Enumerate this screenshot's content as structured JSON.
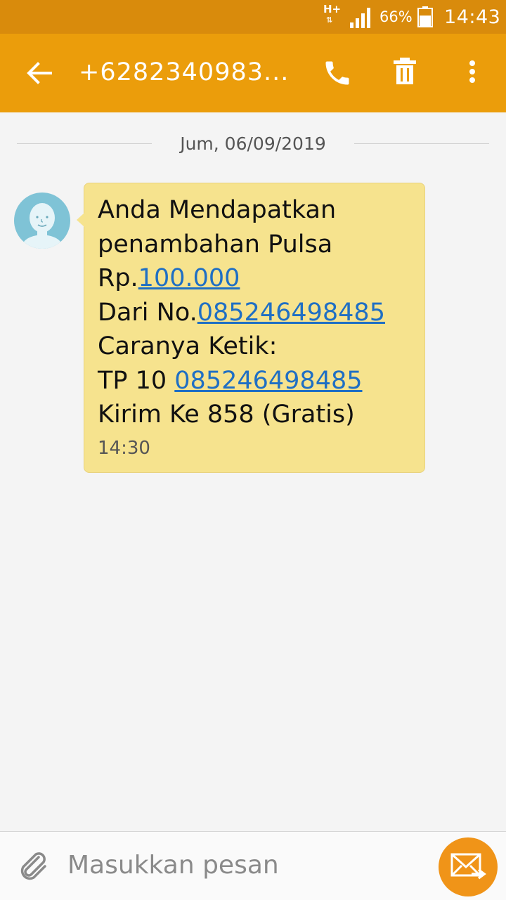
{
  "status_bar": {
    "network": "H+",
    "battery_percent": "66%",
    "time": "14:43",
    "signal_level": 1.0,
    "battery_level": 0.66
  },
  "app_bar": {
    "title": "+6282340983...",
    "back_icon": "arrow-left-icon",
    "call_icon": "phone-icon",
    "delete_icon": "trash-icon",
    "more_icon": "more-vertical-icon"
  },
  "conversation": {
    "date": "Jum, 06/09/2019",
    "message": {
      "line1": "Anda Mendapatkan",
      "line2": "penambahan Pulsa",
      "line3_prefix": "Rp.",
      "line3_link": "100.000",
      "line4_prefix": "Dari No.",
      "line4_link": "085246498485",
      "line5": "Caranya Ketik:",
      "line6_prefix": "TP 10 ",
      "line6_link": "085246498485",
      "line7": "Kirim Ke 858 (Gratis)",
      "time": "14:30"
    }
  },
  "composer": {
    "placeholder": "Masukkan pesan",
    "attach_icon": "paperclip-icon",
    "send_icon": "send-message-icon"
  },
  "colors": {
    "status_bar": "#d98b0c",
    "app_bar": "#eb9d0b",
    "bubble": "#f6e38e",
    "link": "#1f6fc4",
    "send_button": "#f09418",
    "avatar": "#7fc3d6"
  }
}
